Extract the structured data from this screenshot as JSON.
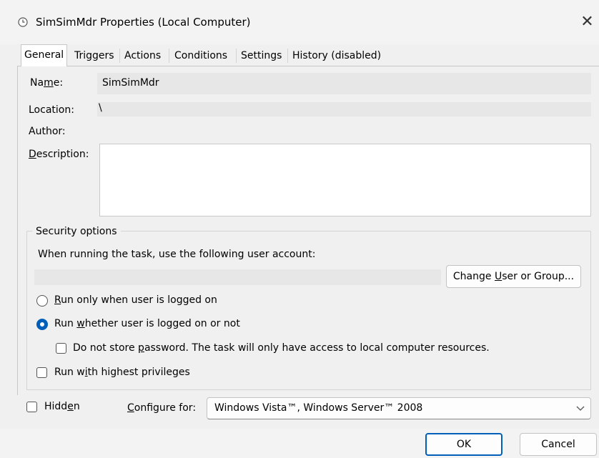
{
  "window": {
    "title": "SimSimMdr Properties (Local Computer)",
    "close_glyph": "✕"
  },
  "tabs": [
    {
      "label": "General"
    },
    {
      "label": "Triggers"
    },
    {
      "label": "Actions"
    },
    {
      "label": "Conditions"
    },
    {
      "label": "Settings"
    },
    {
      "label": "History (disabled)"
    }
  ],
  "general": {
    "name_label_pre": "Na",
    "name_label_u": "m",
    "name_label_post": "e:",
    "name_value": "SimSimMdr",
    "location_label": "Location:",
    "location_value": "\\",
    "author_label": "Author:",
    "author_value": "",
    "description_label_u": "D",
    "description_label_post": "escription:",
    "description_value": ""
  },
  "security": {
    "legend": "Security options",
    "account_prompt": "When running the task, use the following user account:",
    "account_value": "",
    "change_button_pre": "Change ",
    "change_button_u": "U",
    "change_button_post": "ser or Group...",
    "radio1_u": "R",
    "radio1_post": "un only when user is logged on",
    "radio2_pre": "Run ",
    "radio2_u": "w",
    "radio2_post": "hether user is logged on or not",
    "dont_store_pre": "Do not store ",
    "dont_store_u": "p",
    "dont_store_post": "assword.  The task will only have access to local computer resources.",
    "highest_pre": "Run w",
    "highest_u": "i",
    "highest_post": "th highest privileges"
  },
  "footer": {
    "hidden_pre": "Hidd",
    "hidden_u": "e",
    "hidden_post": "n",
    "configure_u": "C",
    "configure_post": "onfigure for:",
    "configure_value": "Windows Vista™, Windows Server™ 2008",
    "ok_label": "OK",
    "cancel_label": "Cancel"
  },
  "state": {
    "radio_selected": "run-whether-logged-on",
    "dont_store_password": false,
    "highest_privileges": false,
    "hidden": false
  },
  "colors": {
    "accent": "#005fb8"
  }
}
